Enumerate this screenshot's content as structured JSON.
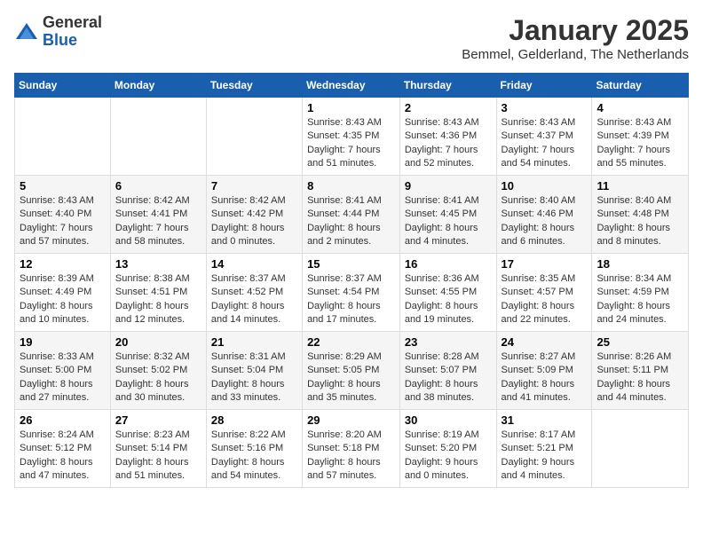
{
  "header": {
    "logo_general": "General",
    "logo_blue": "Blue",
    "month_title": "January 2025",
    "location": "Bemmel, Gelderland, The Netherlands"
  },
  "weekdays": [
    "Sunday",
    "Monday",
    "Tuesday",
    "Wednesday",
    "Thursday",
    "Friday",
    "Saturday"
  ],
  "weeks": [
    [
      {
        "day": "",
        "sunrise": "",
        "sunset": "",
        "daylight": ""
      },
      {
        "day": "",
        "sunrise": "",
        "sunset": "",
        "daylight": ""
      },
      {
        "day": "",
        "sunrise": "",
        "sunset": "",
        "daylight": ""
      },
      {
        "day": "1",
        "sunrise": "Sunrise: 8:43 AM",
        "sunset": "Sunset: 4:35 PM",
        "daylight": "Daylight: 7 hours and 51 minutes."
      },
      {
        "day": "2",
        "sunrise": "Sunrise: 8:43 AM",
        "sunset": "Sunset: 4:36 PM",
        "daylight": "Daylight: 7 hours and 52 minutes."
      },
      {
        "day": "3",
        "sunrise": "Sunrise: 8:43 AM",
        "sunset": "Sunset: 4:37 PM",
        "daylight": "Daylight: 7 hours and 54 minutes."
      },
      {
        "day": "4",
        "sunrise": "Sunrise: 8:43 AM",
        "sunset": "Sunset: 4:39 PM",
        "daylight": "Daylight: 7 hours and 55 minutes."
      }
    ],
    [
      {
        "day": "5",
        "sunrise": "Sunrise: 8:43 AM",
        "sunset": "Sunset: 4:40 PM",
        "daylight": "Daylight: 7 hours and 57 minutes."
      },
      {
        "day": "6",
        "sunrise": "Sunrise: 8:42 AM",
        "sunset": "Sunset: 4:41 PM",
        "daylight": "Daylight: 7 hours and 58 minutes."
      },
      {
        "day": "7",
        "sunrise": "Sunrise: 8:42 AM",
        "sunset": "Sunset: 4:42 PM",
        "daylight": "Daylight: 8 hours and 0 minutes."
      },
      {
        "day": "8",
        "sunrise": "Sunrise: 8:41 AM",
        "sunset": "Sunset: 4:44 PM",
        "daylight": "Daylight: 8 hours and 2 minutes."
      },
      {
        "day": "9",
        "sunrise": "Sunrise: 8:41 AM",
        "sunset": "Sunset: 4:45 PM",
        "daylight": "Daylight: 8 hours and 4 minutes."
      },
      {
        "day": "10",
        "sunrise": "Sunrise: 8:40 AM",
        "sunset": "Sunset: 4:46 PM",
        "daylight": "Daylight: 8 hours and 6 minutes."
      },
      {
        "day": "11",
        "sunrise": "Sunrise: 8:40 AM",
        "sunset": "Sunset: 4:48 PM",
        "daylight": "Daylight: 8 hours and 8 minutes."
      }
    ],
    [
      {
        "day": "12",
        "sunrise": "Sunrise: 8:39 AM",
        "sunset": "Sunset: 4:49 PM",
        "daylight": "Daylight: 8 hours and 10 minutes."
      },
      {
        "day": "13",
        "sunrise": "Sunrise: 8:38 AM",
        "sunset": "Sunset: 4:51 PM",
        "daylight": "Daylight: 8 hours and 12 minutes."
      },
      {
        "day": "14",
        "sunrise": "Sunrise: 8:37 AM",
        "sunset": "Sunset: 4:52 PM",
        "daylight": "Daylight: 8 hours and 14 minutes."
      },
      {
        "day": "15",
        "sunrise": "Sunrise: 8:37 AM",
        "sunset": "Sunset: 4:54 PM",
        "daylight": "Daylight: 8 hours and 17 minutes."
      },
      {
        "day": "16",
        "sunrise": "Sunrise: 8:36 AM",
        "sunset": "Sunset: 4:55 PM",
        "daylight": "Daylight: 8 hours and 19 minutes."
      },
      {
        "day": "17",
        "sunrise": "Sunrise: 8:35 AM",
        "sunset": "Sunset: 4:57 PM",
        "daylight": "Daylight: 8 hours and 22 minutes."
      },
      {
        "day": "18",
        "sunrise": "Sunrise: 8:34 AM",
        "sunset": "Sunset: 4:59 PM",
        "daylight": "Daylight: 8 hours and 24 minutes."
      }
    ],
    [
      {
        "day": "19",
        "sunrise": "Sunrise: 8:33 AM",
        "sunset": "Sunset: 5:00 PM",
        "daylight": "Daylight: 8 hours and 27 minutes."
      },
      {
        "day": "20",
        "sunrise": "Sunrise: 8:32 AM",
        "sunset": "Sunset: 5:02 PM",
        "daylight": "Daylight: 8 hours and 30 minutes."
      },
      {
        "day": "21",
        "sunrise": "Sunrise: 8:31 AM",
        "sunset": "Sunset: 5:04 PM",
        "daylight": "Daylight: 8 hours and 33 minutes."
      },
      {
        "day": "22",
        "sunrise": "Sunrise: 8:29 AM",
        "sunset": "Sunset: 5:05 PM",
        "daylight": "Daylight: 8 hours and 35 minutes."
      },
      {
        "day": "23",
        "sunrise": "Sunrise: 8:28 AM",
        "sunset": "Sunset: 5:07 PM",
        "daylight": "Daylight: 8 hours and 38 minutes."
      },
      {
        "day": "24",
        "sunrise": "Sunrise: 8:27 AM",
        "sunset": "Sunset: 5:09 PM",
        "daylight": "Daylight: 8 hours and 41 minutes."
      },
      {
        "day": "25",
        "sunrise": "Sunrise: 8:26 AM",
        "sunset": "Sunset: 5:11 PM",
        "daylight": "Daylight: 8 hours and 44 minutes."
      }
    ],
    [
      {
        "day": "26",
        "sunrise": "Sunrise: 8:24 AM",
        "sunset": "Sunset: 5:12 PM",
        "daylight": "Daylight: 8 hours and 47 minutes."
      },
      {
        "day": "27",
        "sunrise": "Sunrise: 8:23 AM",
        "sunset": "Sunset: 5:14 PM",
        "daylight": "Daylight: 8 hours and 51 minutes."
      },
      {
        "day": "28",
        "sunrise": "Sunrise: 8:22 AM",
        "sunset": "Sunset: 5:16 PM",
        "daylight": "Daylight: 8 hours and 54 minutes."
      },
      {
        "day": "29",
        "sunrise": "Sunrise: 8:20 AM",
        "sunset": "Sunset: 5:18 PM",
        "daylight": "Daylight: 8 hours and 57 minutes."
      },
      {
        "day": "30",
        "sunrise": "Sunrise: 8:19 AM",
        "sunset": "Sunset: 5:20 PM",
        "daylight": "Daylight: 9 hours and 0 minutes."
      },
      {
        "day": "31",
        "sunrise": "Sunrise: 8:17 AM",
        "sunset": "Sunset: 5:21 PM",
        "daylight": "Daylight: 9 hours and 4 minutes."
      },
      {
        "day": "",
        "sunrise": "",
        "sunset": "",
        "daylight": ""
      }
    ]
  ]
}
